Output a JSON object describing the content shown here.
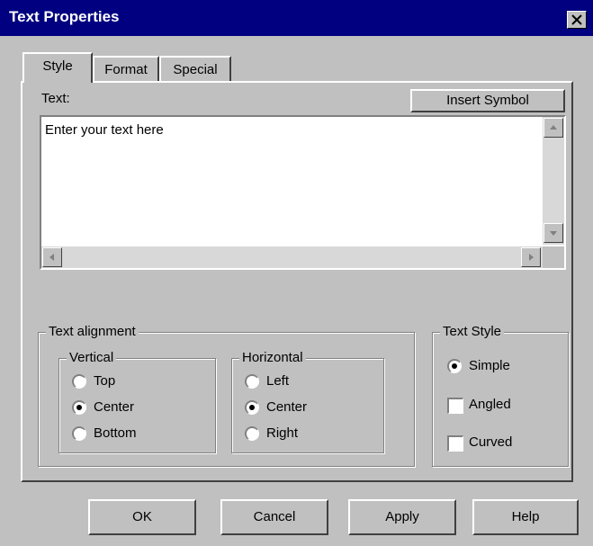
{
  "window": {
    "title": "Text Properties"
  },
  "tabs": [
    {
      "label": "Style",
      "active": true
    },
    {
      "label": "Format",
      "active": false
    },
    {
      "label": "Special",
      "active": false
    }
  ],
  "text_section": {
    "label": "Text:",
    "insert_symbol_label": "Insert Symbol",
    "value": "Enter your text here"
  },
  "alignment": {
    "title": "Text alignment",
    "vertical": {
      "title": "Vertical",
      "options": [
        "Top",
        "Center",
        "Bottom"
      ],
      "selected": "Center"
    },
    "horizontal": {
      "title": "Horizontal",
      "options": [
        "Left",
        "Center",
        "Right"
      ],
      "selected": "Center"
    }
  },
  "text_style": {
    "title": "Text Style",
    "radio_label": "Simple",
    "radio_selected": true,
    "checkboxes": [
      {
        "label": "Angled",
        "checked": false
      },
      {
        "label": "Curved",
        "checked": false
      }
    ]
  },
  "buttons": {
    "ok": "OK",
    "cancel": "Cancel",
    "apply": "Apply",
    "help": "Help"
  },
  "colors": {
    "titlebar": "#000080",
    "face": "#c0c0c0"
  }
}
